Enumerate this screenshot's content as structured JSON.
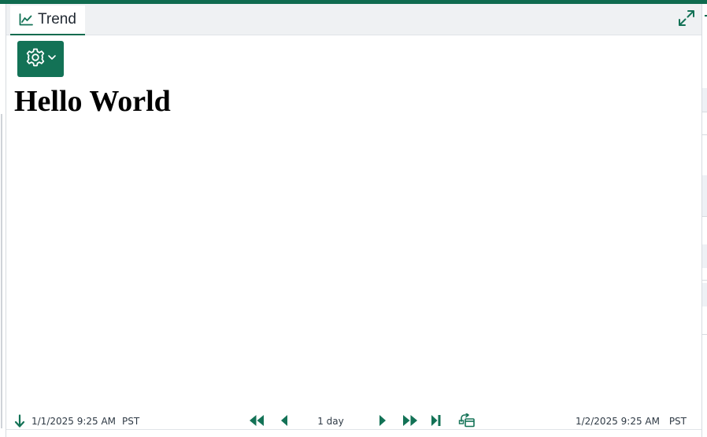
{
  "tab": {
    "label": "Trend",
    "icon": "line-chart-icon"
  },
  "header": {
    "expand_icon": "expand-icon"
  },
  "toolbar": {
    "settings_icon": "gear-icon",
    "dropdown_icon": "chevron-down-icon"
  },
  "content": {
    "headline": "Hello World"
  },
  "time_bar": {
    "start_time": "1/1/2025 9:25 AM",
    "start_timezone": "PST",
    "duration": "1 day",
    "end_time": "1/2/2025 9:25 AM",
    "end_timezone": "PST",
    "icons": {
      "start": "arrow-down-icon",
      "step_back_large": "fast-rewind-icon",
      "step_back": "step-back-icon",
      "step_forward": "step-forward-icon",
      "step_forward_large": "fast-forward-icon",
      "go_to_now": "skip-to-end-icon",
      "sync": "sync-display-icon"
    }
  },
  "colors": {
    "accent": "#137256",
    "top_strip": "#0f6b4f",
    "tab_bar_bg": "#eff1f3",
    "text": "#2f3a45"
  }
}
